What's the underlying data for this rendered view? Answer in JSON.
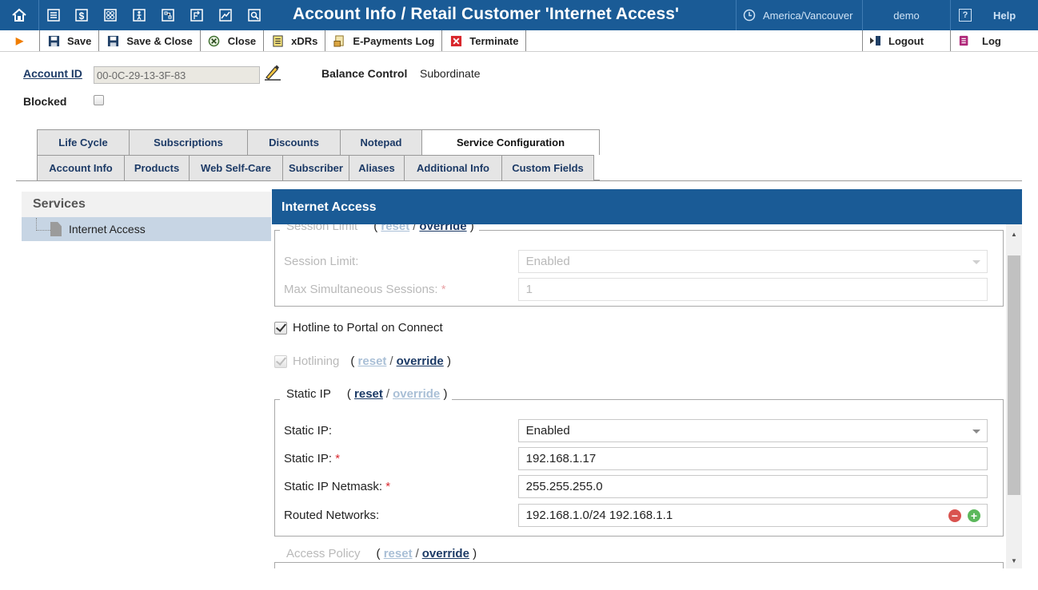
{
  "header": {
    "title": "Account Info / Retail Customer 'Internet Access'",
    "nav_icons": [
      "home-icon",
      "list-icon",
      "dollar-icon",
      "modules-icon",
      "person-icon",
      "network-icon",
      "routing-icon",
      "chart-icon",
      "search-doc-icon"
    ],
    "timezone": "America/Vancouver",
    "user": "demo",
    "help_label": "Help"
  },
  "toolbar": {
    "save": "Save",
    "save_close": "Save & Close",
    "close": "Close",
    "xdrs": "xDRs",
    "epayments": "E-Payments Log",
    "terminate": "Terminate",
    "logout": "Logout",
    "log": "Log"
  },
  "account": {
    "id_label": "Account ID",
    "id_value": "00-0C-29-13-3F-83",
    "balance_control_label": "Balance Control",
    "balance_control_value": "Subordinate",
    "blocked_label": "Blocked",
    "blocked": false
  },
  "tabs": {
    "row1": [
      "Life Cycle",
      "Subscriptions",
      "Discounts",
      "Notepad",
      "Service Configuration"
    ],
    "row2": [
      "Account Info",
      "Products",
      "Web Self-Care",
      "Subscriber",
      "Aliases",
      "Additional Info",
      "Custom Fields"
    ],
    "active": "Service Configuration"
  },
  "services": {
    "title": "Services",
    "items": [
      "Internet Access"
    ],
    "selected": "Internet Access"
  },
  "panel": {
    "title": "Internet Access",
    "session_limit": {
      "legend": "Session Limit",
      "reset": "reset",
      "override": "override",
      "fields": [
        {
          "label": "Session Limit:",
          "value": "Enabled",
          "required": false
        },
        {
          "label": "Max Simultaneous Sessions:",
          "value": "1",
          "required": true
        }
      ]
    },
    "hotline_portal": {
      "label": "Hotline to Portal on Connect",
      "checked": true
    },
    "hotlining": {
      "label": "Hotlining",
      "checked": true,
      "reset": "reset",
      "override": "override"
    },
    "static_ip": {
      "legend": "Static IP",
      "reset": "reset",
      "override": "override",
      "fields": [
        {
          "label": "Static IP:",
          "value": "Enabled",
          "required": false
        },
        {
          "label": "Static IP:",
          "value": "192.168.1.17",
          "required": true
        },
        {
          "label": "Static IP Netmask:",
          "value": "255.255.255.0",
          "required": true
        },
        {
          "label": "Routed Networks:",
          "value": "192.168.1.0/24 192.168.1.1",
          "required": false
        }
      ]
    },
    "access_policy": {
      "legend": "Access Policy",
      "reset": "reset",
      "override": "override"
    },
    "required_mark": "*",
    "separator": "/",
    "open_paren": "(",
    "close_paren": ")"
  }
}
